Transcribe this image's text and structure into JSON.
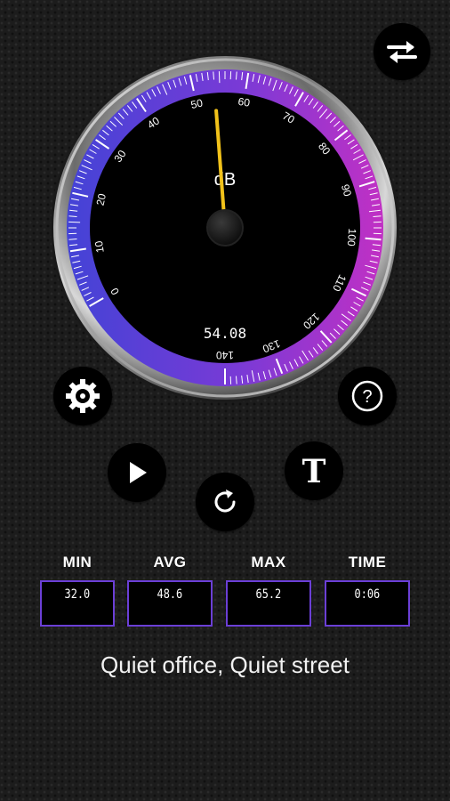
{
  "gauge": {
    "unit_label": "dB",
    "current_reading": 54,
    "display_value": "54.08",
    "scale_min": 0,
    "scale_max": 140,
    "tick_labels": [
      "0",
      "10",
      "20",
      "30",
      "40",
      "50",
      "60",
      "70",
      "80",
      "90",
      "100",
      "110",
      "120",
      "130",
      "140"
    ],
    "needle_color": "#f2c21a",
    "gradient_start": "#4a4ad8",
    "gradient_end": "#c02fc2"
  },
  "buttons": {
    "swap_icon": "swap-arrows-icon",
    "settings_icon": "gear-icon",
    "help_icon": "help-icon",
    "play_icon": "play-icon",
    "reset_icon": "refresh-icon",
    "text_icon": "text-t-icon",
    "help_glyph": "?",
    "text_glyph": "T"
  },
  "stats": {
    "min_label": "MIN",
    "min_value": "32.0",
    "avg_label": "AVG",
    "avg_value": "48.6",
    "max_label": "MAX",
    "max_value": "65.2",
    "time_label": "TIME",
    "time_value": "0:06"
  },
  "description": "Quiet office, Quiet street",
  "colors": {
    "box_border": "#6b3fd6",
    "background": "#1c1c1c"
  }
}
